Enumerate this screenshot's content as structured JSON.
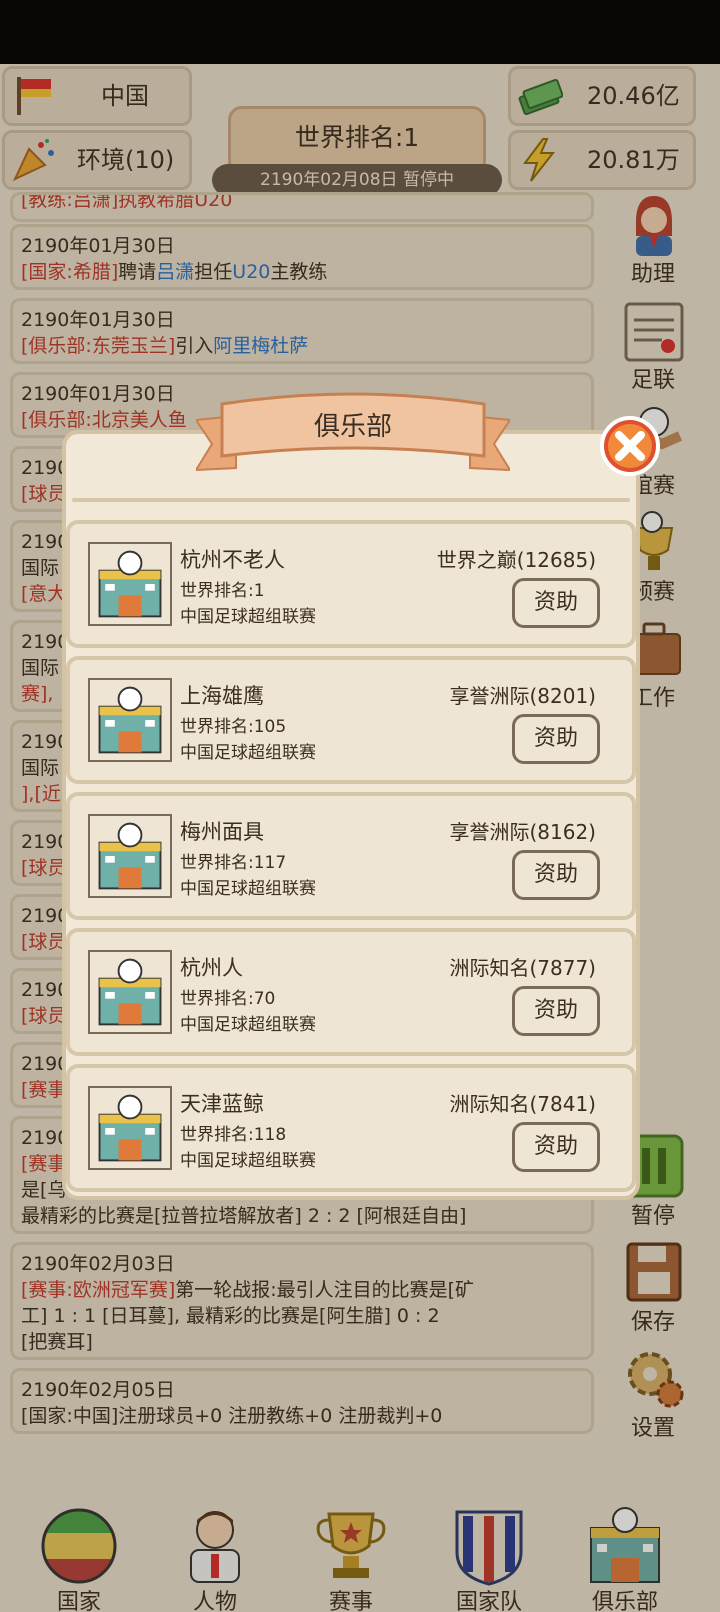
{
  "header": {
    "country": "中国",
    "environment": "环境(10)",
    "money": "20.46亿",
    "energy": "20.81万",
    "world_rank_title": "世界排名:1",
    "date_status": "2190年02月08日  暂停中"
  },
  "feed": [
    {
      "partial": "[教练:吕潇]执教希腊U20"
    },
    {
      "date": "2190年01月30日",
      "tag": "[国家:希腊]",
      "t1": "聘请",
      "name": "吕潇",
      "t2": "担任",
      "name2": "U20",
      "t3": "主教练"
    },
    {
      "date": "2190年01月30日",
      "tag": "[俱乐部:东莞玉兰]",
      "t1": "引入",
      "name": "阿里梅杜萨"
    },
    {
      "date": "2190年01月30日",
      "tag": "[俱乐部:北京美人鱼"
    },
    {
      "date": "2190",
      "tag": "[球员"
    },
    {
      "date": "2190",
      "l1": "国际",
      "tag": "[意大"
    },
    {
      "date": "2190",
      "l1": "国际",
      "tag": "赛],"
    },
    {
      "date": "2190",
      "l1": "国际",
      "tag": "],[近"
    },
    {
      "date": "2190",
      "tag": "[球员"
    },
    {
      "date": "2190",
      "tag": "[球员"
    },
    {
      "date": "2190",
      "tag": "[球员"
    },
    {
      "date": "2190",
      "tag": "[赛事"
    },
    {
      "date": "2190",
      "tag": "[赛事",
      "l1": "是[乌",
      "l2": "最精彩的比赛是[拉普拉塔解放者]  2 : 2  [阿根廷自由]"
    },
    {
      "date": "2190年02月03日",
      "tag": "[赛事:欧洲冠军赛]",
      "t1": "第一轮战报:最引人注目的比赛是[矿",
      "l1": "工]  1 : 1  [日耳蔓], 最精彩的比赛是[阿生腊]  0 : 2",
      "l2": "[把赛耳]"
    },
    {
      "date": "2190年02月05日",
      "t1": "[国家:中国]注册球员+0  注册教练+0  注册裁判+0"
    }
  ],
  "side": {
    "assistant": "助理",
    "football": "足联",
    "friendly": "谊赛",
    "qualifier": "预赛",
    "work": "工作",
    "pause": "暂停",
    "save": "保存",
    "settings": "设置"
  },
  "nav": [
    "国家",
    "人物",
    "赛事",
    "国家队",
    "俱乐部"
  ],
  "modal": {
    "title": "俱乐部",
    "sponsor_label": "资助",
    "clubs": [
      {
        "name": "杭州不老人",
        "rank": "世界排名:1",
        "league": "中国足球超组联赛",
        "tier": "世界之巅(12685)"
      },
      {
        "name": "上海雄鹰",
        "rank": "世界排名:105",
        "league": "中国足球超组联赛",
        "tier": "享誉洲际(8201)"
      },
      {
        "name": "梅州面具",
        "rank": "世界排名:117",
        "league": "中国足球超组联赛",
        "tier": "享誉洲际(8162)"
      },
      {
        "name": "杭州人",
        "rank": "世界排名:70",
        "league": "中国足球超组联赛",
        "tier": "洲际知名(7877)"
      },
      {
        "name": "天津蓝鲸",
        "rank": "世界排名:118",
        "league": "中国足球超组联赛",
        "tier": "洲际知名(7841)"
      }
    ]
  },
  "colors": {
    "accent_red": "#c0392b",
    "link_blue": "#2a73c8",
    "bg": "#e9dfcd"
  }
}
